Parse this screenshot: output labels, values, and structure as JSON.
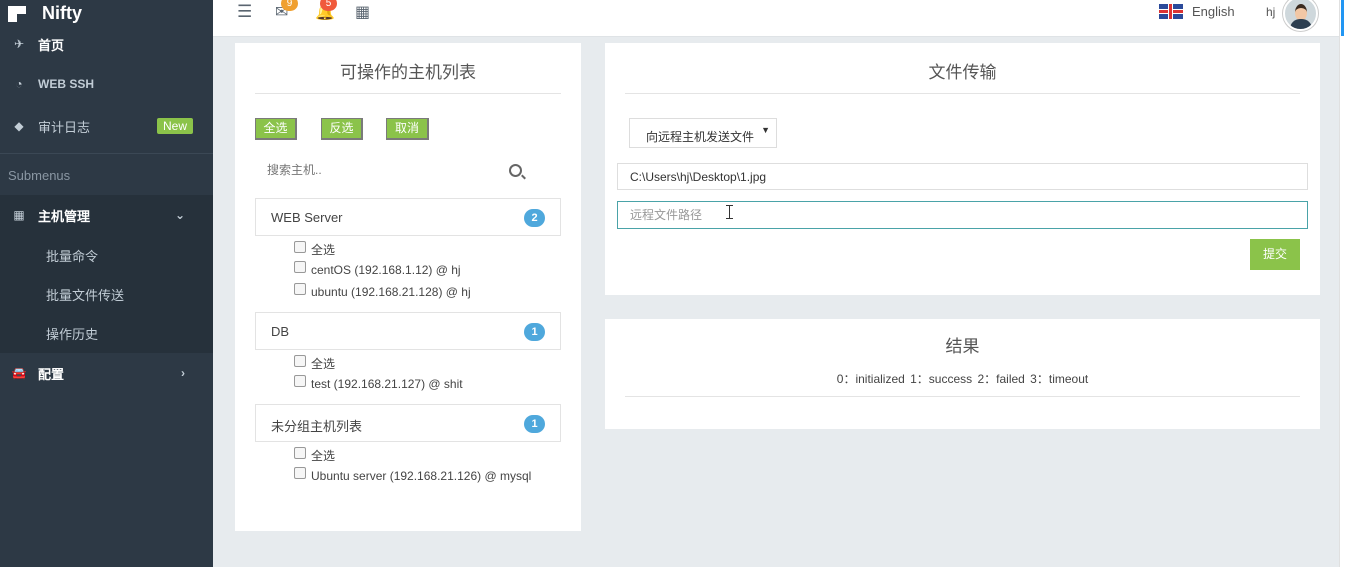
{
  "app": {
    "brand": "Nifty"
  },
  "sidebar": {
    "items": [
      {
        "label": "首页",
        "icon": "plane-icon"
      },
      {
        "label": "WEB SSH",
        "icon": "dashboard-icon"
      },
      {
        "label": "审计日志",
        "icon": "tag-icon",
        "badge": "New"
      }
    ],
    "group_label": "Submenus",
    "host_mgmt": {
      "label": "主机管理",
      "icon": "grid-icon",
      "expanded": true
    },
    "sub_items": [
      "批量命令",
      "批量文件传送",
      "操作历史"
    ],
    "config": {
      "label": "配置",
      "icon": "car-icon"
    }
  },
  "topbar": {
    "mail_count": "9",
    "notify_count": "5",
    "language": "English",
    "username": "hj",
    "colors": {
      "mail_badge": "#f0a030",
      "notify_badge": "#f05a3c"
    }
  },
  "host_panel": {
    "title": "可操作的主机列表",
    "buttons": {
      "select_all": "全选",
      "invert": "反选",
      "cancel": "取消"
    },
    "search_placeholder": "搜索主机..",
    "groups": [
      {
        "name": "WEB Server",
        "count": "2",
        "select_all": "全选",
        "hosts": [
          "centOS (192.168.1.12) @ hj",
          "ubuntu (192.168.21.128) @ hj"
        ]
      },
      {
        "name": "DB",
        "count": "1",
        "select_all": "全选",
        "hosts": [
          "test (192.168.21.127) @ shit"
        ]
      },
      {
        "name": "未分组主机列表",
        "count": "1",
        "select_all": "全选",
        "hosts": [
          "Ubuntu server (192.168.21.126) @ mysql"
        ]
      }
    ]
  },
  "transfer_panel": {
    "title": "文件传输",
    "direction_selected": "向远程主机发送文件",
    "local_path_value": "C:\\Users\\hj\\Desktop\\1.jpg",
    "remote_path_placeholder": "远程文件路径",
    "submit": "提交"
  },
  "result_panel": {
    "title": "结果",
    "legend": "0：initialized   1：success   2：failed   3：timeout"
  },
  "colors": {
    "accent_green": "#8bc34a",
    "sidebar_bg": "#2d3945",
    "badge_blue": "#4fa8dc"
  }
}
